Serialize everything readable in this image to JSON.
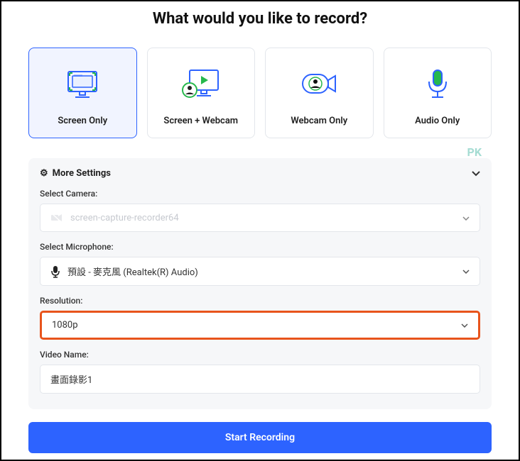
{
  "title": "What would you like to record?",
  "cards": [
    {
      "label": "Screen Only",
      "selected": true
    },
    {
      "label": "Screen + Webcam",
      "selected": false
    },
    {
      "label": "Webcam Only",
      "selected": false
    },
    {
      "label": "Audio Only",
      "selected": false
    }
  ],
  "settings": {
    "heading": "More Settings",
    "camera_label": "Select Camera:",
    "camera_value": "screen-capture-recorder64",
    "microphone_label": "Select Microphone:",
    "microphone_value": "預設 - 麥克風 (Realtek(R) Audio)",
    "resolution_label": "Resolution:",
    "resolution_value": "1080p",
    "video_name_label": "Video Name:",
    "video_name_value": "畫面錄影1"
  },
  "start_button": "Start Recording",
  "watermark": "PK"
}
